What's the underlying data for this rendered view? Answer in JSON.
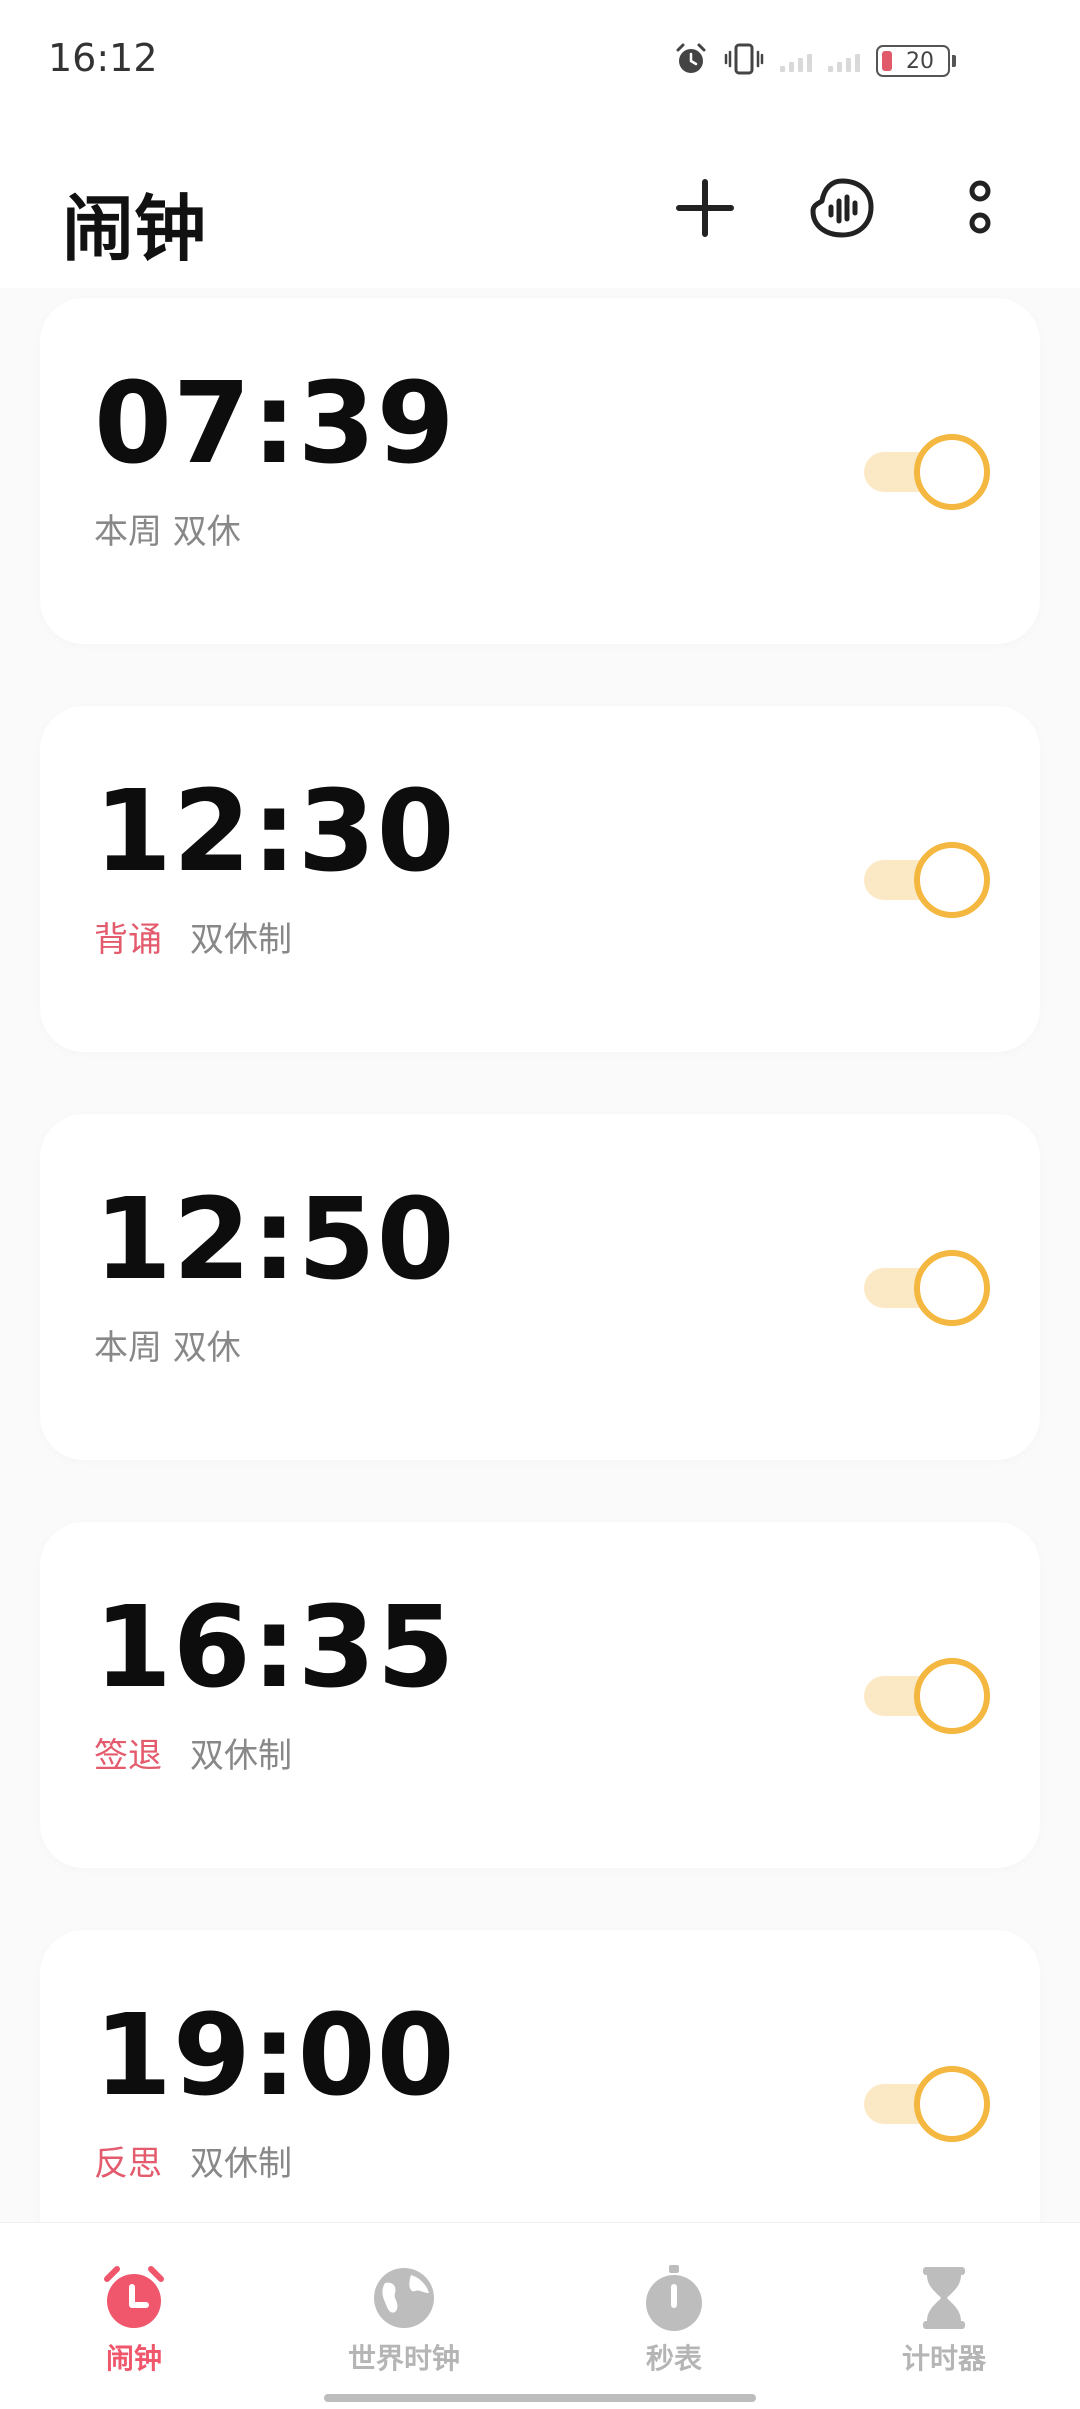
{
  "status_bar": {
    "time": "16:12",
    "battery_level": "20"
  },
  "header": {
    "title": "闹钟"
  },
  "alarms": [
    {
      "time": "07:39",
      "label": "",
      "repeat": "本周 双休",
      "enabled": true
    },
    {
      "time": "12:30",
      "label": "背诵",
      "repeat": "双休制",
      "enabled": true
    },
    {
      "time": "12:50",
      "label": "",
      "repeat": "本周 双休",
      "enabled": true
    },
    {
      "time": "16:35",
      "label": "签退",
      "repeat": "双休制",
      "enabled": true
    },
    {
      "time": "19:00",
      "label": "反思",
      "repeat": "双休制",
      "enabled": true
    }
  ],
  "nav": {
    "alarm": "闹钟",
    "world_clock": "世界时钟",
    "stopwatch": "秒表",
    "timer": "计时器"
  },
  "colors": {
    "accent_red": "#f0566c",
    "toggle_orange": "#f4b740",
    "toggle_track": "#fbe8c5"
  },
  "icons": {
    "add": "plus-icon",
    "voice": "voice-icon",
    "more": "more-vertical-icon",
    "alarm": "alarm-clock-icon",
    "world_clock": "globe-icon",
    "stopwatch": "stopwatch-icon",
    "timer": "hourglass-icon"
  }
}
